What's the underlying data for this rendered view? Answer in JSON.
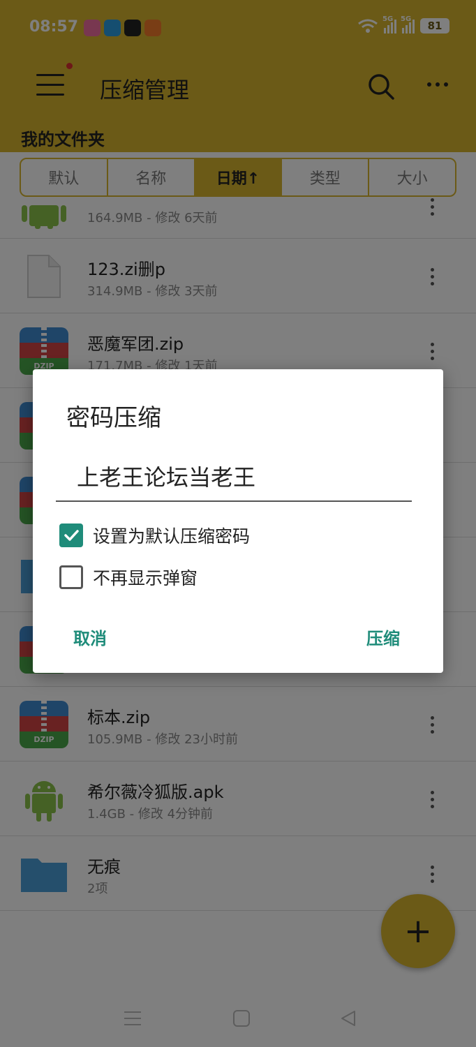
{
  "status_bar": {
    "time": "08:57",
    "network1": "5G",
    "network2": "5G",
    "battery": "81"
  },
  "toolbar": {
    "title": "压缩管理",
    "menu_icon": "hamburger-menu-icon",
    "search_icon": "search-icon",
    "more_icon": "more-horizontal-icon"
  },
  "breadcrumb": {
    "label": "我的文件夹"
  },
  "sort_tabs": [
    {
      "label": "默认"
    },
    {
      "label": "名称"
    },
    {
      "label": "日期↑",
      "active": true
    },
    {
      "label": "类型"
    },
    {
      "label": "大小"
    }
  ],
  "files": [
    {
      "name": "",
      "meta": "164.9MB - 修改 6天前",
      "icon": "android-icon"
    },
    {
      "name": "123.zi删p",
      "meta": "314.9MB - 修改 3天前",
      "icon": "file-icon"
    },
    {
      "name": "恶魔军团.zip",
      "meta": "171.7MB - 修改 1天前",
      "icon": "zip-icon"
    },
    {
      "name": "",
      "meta": "",
      "icon": "zip-icon"
    },
    {
      "name": "",
      "meta": "",
      "icon": "zip-icon"
    },
    {
      "name": "",
      "meta": "",
      "icon": "folder-icon"
    },
    {
      "name": "",
      "meta": "",
      "icon": "zip-icon"
    },
    {
      "name": "标本.zip",
      "meta": "105.9MB - 修改 23小时前",
      "icon": "zip-icon"
    },
    {
      "name": "希尔薇冷狐版.apk",
      "meta": "1.4GB - 修改 4分钟前",
      "icon": "android-icon"
    },
    {
      "name": "无痕",
      "meta": "2项",
      "icon": "folder-icon"
    }
  ],
  "zip_badge": "DZIP",
  "fab": {
    "label": "+"
  },
  "dialog": {
    "title": "密码压缩",
    "password_value": "上老王论坛当老王",
    "checkbox_default": {
      "label": "设置为默认压缩密码",
      "checked": true
    },
    "checkbox_no_popup": {
      "label": "不再显示弹窗",
      "checked": false
    },
    "cancel_label": "取消",
    "confirm_label": "压缩"
  },
  "colors": {
    "accent": "#d7b42e",
    "dialog_accent": "#1f8c7a"
  }
}
